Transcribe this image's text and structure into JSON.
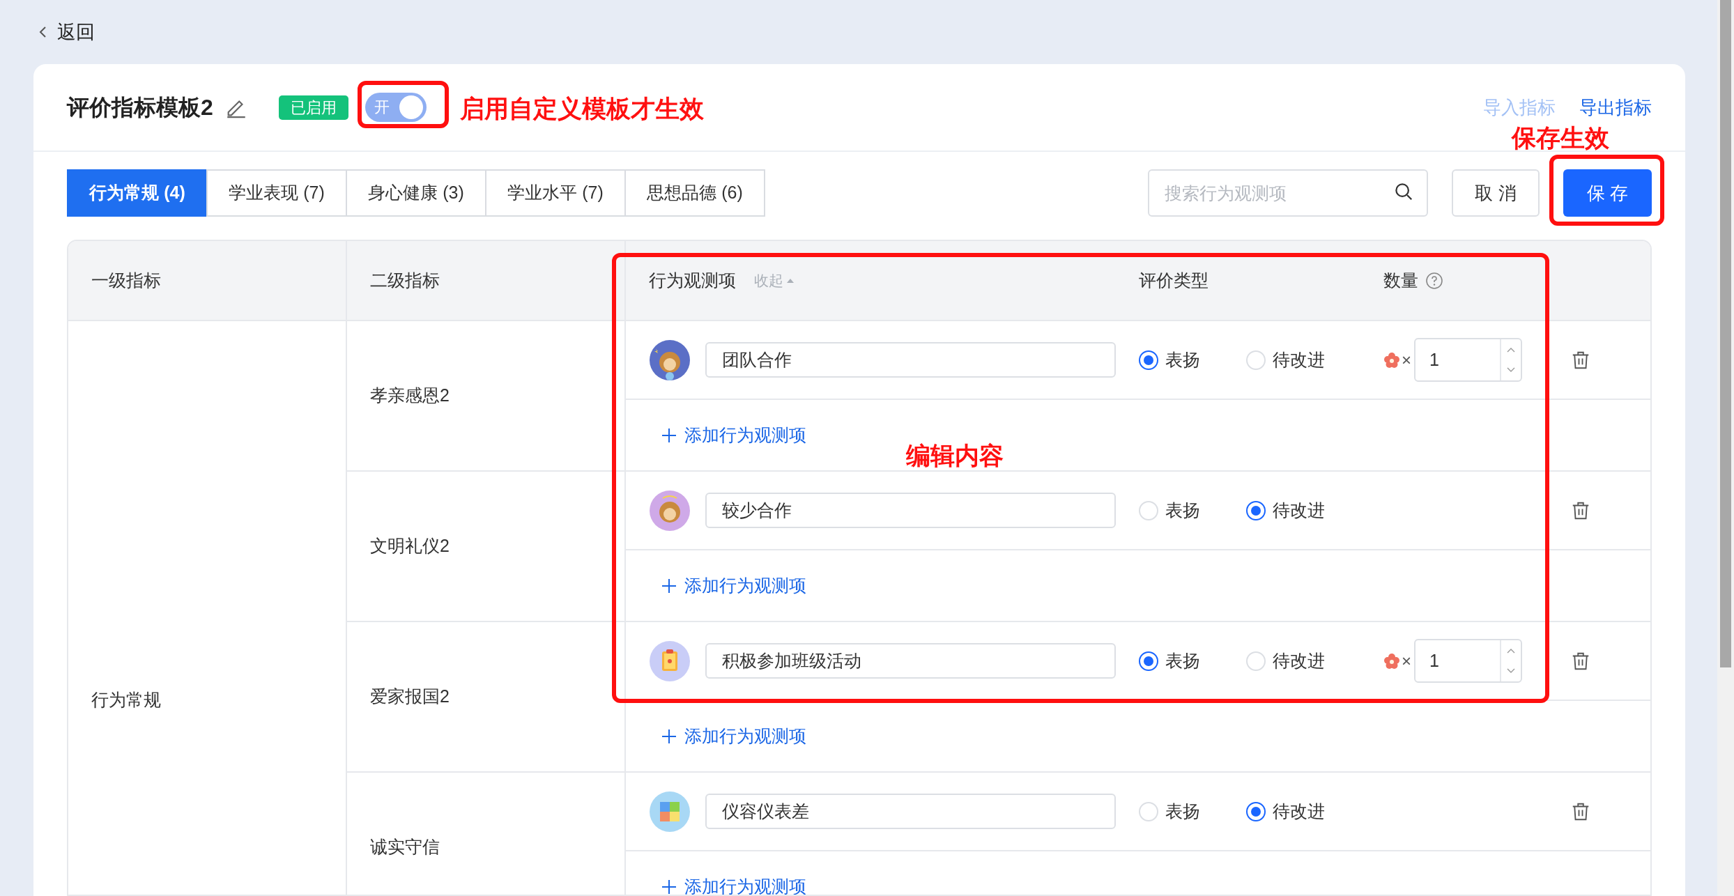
{
  "back": {
    "label": "返回"
  },
  "header": {
    "title": "评价指标模板2",
    "status_badge": "已启用",
    "toggle": {
      "label": "开",
      "on": true
    },
    "links": [
      {
        "label": "导入指标",
        "disabled": true
      },
      {
        "label": "导出指标",
        "disabled": false
      }
    ]
  },
  "tabs": [
    {
      "label": "行为常规 (4)",
      "selected": true
    },
    {
      "label": "学业表现 (7)",
      "selected": false
    },
    {
      "label": "身心健康 (3)",
      "selected": false
    },
    {
      "label": "学业水平 (7)",
      "selected": false
    },
    {
      "label": "思想品德 (6)",
      "selected": false
    }
  ],
  "search": {
    "placeholder": "搜索行为观测项"
  },
  "buttons": [
    {
      "label": "取 消",
      "kind": "secondary"
    },
    {
      "label": "保 存",
      "kind": "primary"
    }
  ],
  "table": {
    "columns": [
      "一级指标",
      "二级指标",
      "行为观测项",
      "评价类型",
      "数量"
    ],
    "collapse_link": "收起",
    "groups": [
      {
        "name": "行为常规",
        "children": [
          {
            "name": "孝亲感恩2",
            "add_link": "添加行为观测项",
            "items": [
              {
                "value": "团队合作",
                "options": [
                  {
                    "label": "表扬",
                    "selected": true
                  },
                  {
                    "label": "待改进",
                    "selected": false
                  }
                ],
                "count": {
                  "sign": "×",
                  "value": "1"
                }
              }
            ]
          },
          {
            "name": "文明礼仪2",
            "add_link": "添加行为观测项",
            "items": [
              {
                "value": "较少合作",
                "options": [
                  {
                    "label": "表扬",
                    "selected": false
                  },
                  {
                    "label": "待改进",
                    "selected": true
                  }
                ]
              }
            ]
          },
          {
            "name": "爱家报国2",
            "add_link": "添加行为观测项",
            "items": [
              {
                "value": "积极参加班级活动",
                "options": [
                  {
                    "label": "表扬",
                    "selected": true
                  },
                  {
                    "label": "待改进",
                    "selected": false
                  }
                ],
                "count": {
                  "sign": "×",
                  "value": "1"
                }
              }
            ]
          },
          {
            "name": "诚实守信",
            "add_link": "添加行为观测项",
            "items": [
              {
                "value": "仪容仪表差",
                "options": [
                  {
                    "label": "表扬",
                    "selected": false
                  },
                  {
                    "label": "待改进",
                    "selected": true
                  }
                ]
              }
            ]
          }
        ]
      }
    ]
  },
  "annotations": [
    {
      "kind": "toggle-frame"
    },
    {
      "kind": "toggle-note",
      "text": "启用自定义模板才生效"
    },
    {
      "kind": "save-note",
      "text": "保存生效"
    },
    {
      "kind": "save-frame"
    },
    {
      "kind": "items-frame"
    },
    {
      "kind": "items-note",
      "text": "编辑内容"
    }
  ]
}
